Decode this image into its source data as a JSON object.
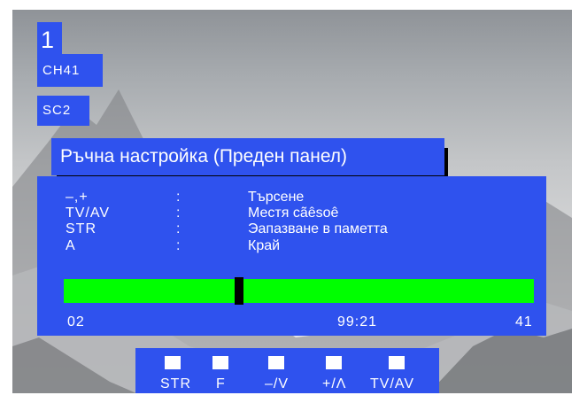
{
  "status": {
    "channel_number": "1",
    "channel_name": "CH41",
    "source": "SC2"
  },
  "menu": {
    "title": "Ръчна настройка (Преден панел)",
    "rows": [
      {
        "key": "–,+",
        "colon": ":",
        "desc": "Търсене"
      },
      {
        "key": "TV/AV",
        "colon": ":",
        "desc": "Местя cãêsoê"
      },
      {
        "key": "STR",
        "colon": ":",
        "desc": "Эапазване в паметта"
      },
      {
        "key": "A",
        "colon": ":",
        "desc": "Край"
      }
    ],
    "tuning": {
      "start_label": "02",
      "end_label": "41",
      "frequency": "99:21",
      "position_fraction": 0.37
    }
  },
  "hint_bar": {
    "keys": [
      {
        "label": "STR"
      },
      {
        "label": "F"
      },
      {
        "label": "–/V"
      },
      {
        "label": "+/Λ"
      },
      {
        "label": "TV/AV"
      }
    ]
  },
  "colors": {
    "osd_blue": "#2f52ee",
    "bar_green": "#00ff00",
    "marker": "#000000"
  }
}
